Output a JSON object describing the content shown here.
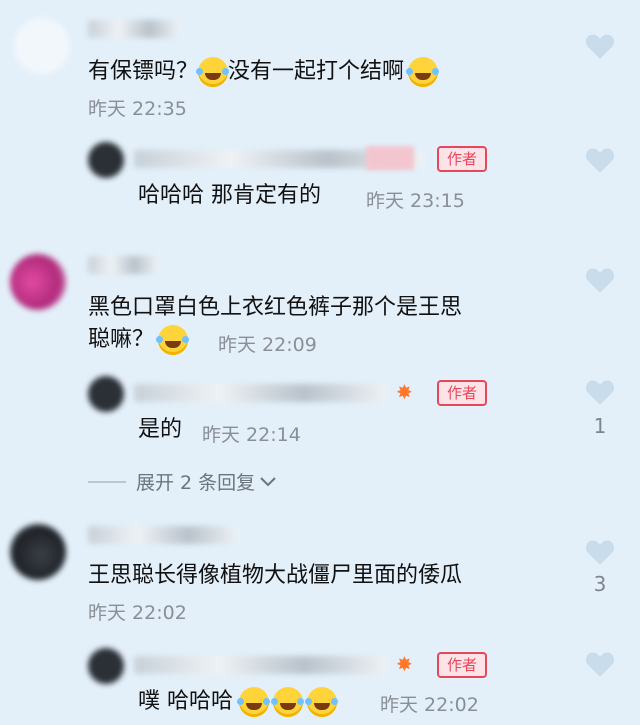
{
  "comments": [
    {
      "text_before_emoji": "有保镖吗？",
      "text_after_emoji": "没有一起打个结啊",
      "time": "昨天 22:35",
      "reply": {
        "badge": "作者",
        "text": "哈哈哈 那肯定有的",
        "time": "昨天 23:15"
      }
    },
    {
      "text_line1": "黑色口罩白色上衣红色裤子那个是王思",
      "text_line2": "聪嘛？",
      "time": "昨天 22:09",
      "reply": {
        "badge": "作者",
        "text": "是的",
        "time": "昨天 22:14",
        "like_count": "1"
      },
      "expand_label": "展开 2 条回复"
    },
    {
      "text": "王思聪长得像植物大战僵尸里面的倭瓜",
      "time": "昨天 22:02",
      "like_count": "3",
      "reply": {
        "badge": "作者",
        "text": "噗 哈哈哈",
        "time": "昨天 22:02"
      }
    }
  ],
  "icons": {
    "heart": "heart-icon",
    "emoji": "laughing-crying-emoji-icon",
    "spark": "spark-icon",
    "chevron": "chevron-down-icon"
  },
  "colors": {
    "background": "#e3f0fa",
    "author_badge": "#e8475b",
    "heart": "#c9dcec"
  }
}
